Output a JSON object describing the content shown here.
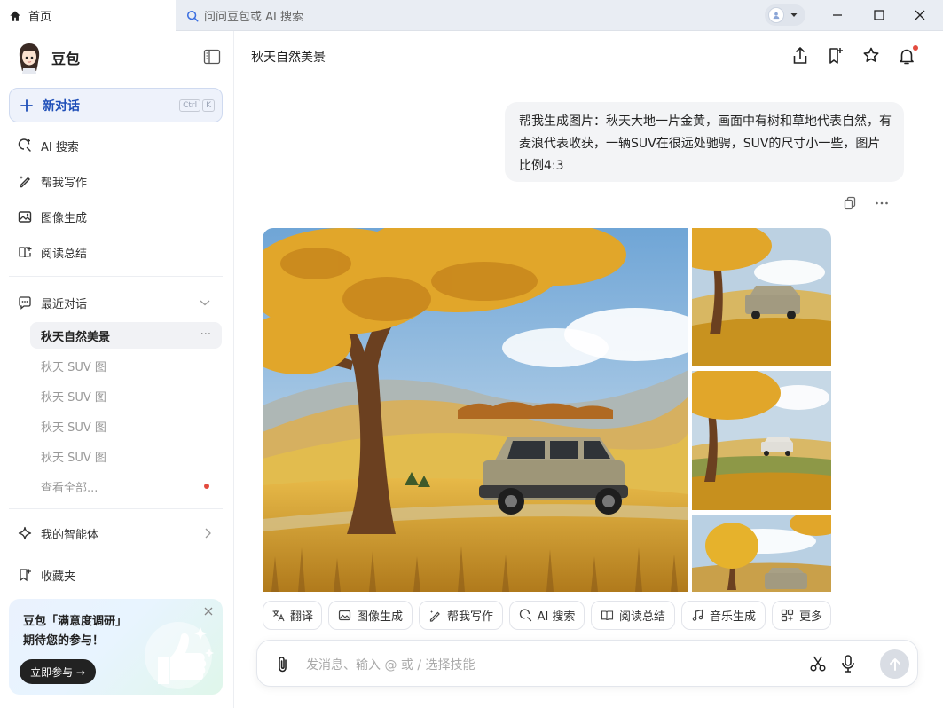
{
  "titlebar": {
    "home_tab": "首页",
    "search_tab": "问问豆包或 AI 搜索"
  },
  "sidebar": {
    "brand": "豆包",
    "new_chat": "新对话",
    "new_chat_keys": [
      "Ctrl",
      "K"
    ],
    "nav": [
      {
        "label": "AI 搜索",
        "icon": "ai-search-icon"
      },
      {
        "label": "帮我写作",
        "icon": "pen-icon"
      },
      {
        "label": "图像生成",
        "icon": "image-icon"
      },
      {
        "label": "阅读总结",
        "icon": "book-icon"
      }
    ],
    "recent_title": "最近对话",
    "recent": [
      {
        "label": "秋天自然美景",
        "active": true
      },
      {
        "label": "秋天 SUV 图"
      },
      {
        "label": "秋天 SUV 图"
      },
      {
        "label": "秋天 SUV 图"
      },
      {
        "label": "秋天 SUV 图"
      }
    ],
    "view_all": "查看全部...",
    "agents": "我的智能体",
    "favorites": "收藏夹",
    "survey": {
      "line1": "豆包「满意度调研」",
      "line2": "期待您的参与！",
      "button": "立即参与 →"
    }
  },
  "main": {
    "title": "秋天自然美景",
    "user_message": "帮我生成图片：秋天大地一片金黄，画面中有树和草地代表自然，有麦浪代表收获，一辆SUV在很远处驰骋，SUV的尺寸小一些，图片比例4:3",
    "toolbar": [
      {
        "label": "翻译",
        "icon": "translate-icon"
      },
      {
        "label": "图像生成",
        "icon": "image-icon"
      },
      {
        "label": "帮我写作",
        "icon": "pen-icon"
      },
      {
        "label": "AI 搜索",
        "icon": "ai-search-icon"
      },
      {
        "label": "阅读总结",
        "icon": "book-icon"
      },
      {
        "label": "音乐生成",
        "icon": "music-icon"
      },
      {
        "label": "更多",
        "icon": "grid-icon"
      }
    ],
    "input_placeholder": "发消息、输入 @ 或 / 选择技能"
  },
  "colors": {
    "accent": "#1f4fb8",
    "notification": "#e34b3f",
    "gold": "#e2a92b"
  }
}
